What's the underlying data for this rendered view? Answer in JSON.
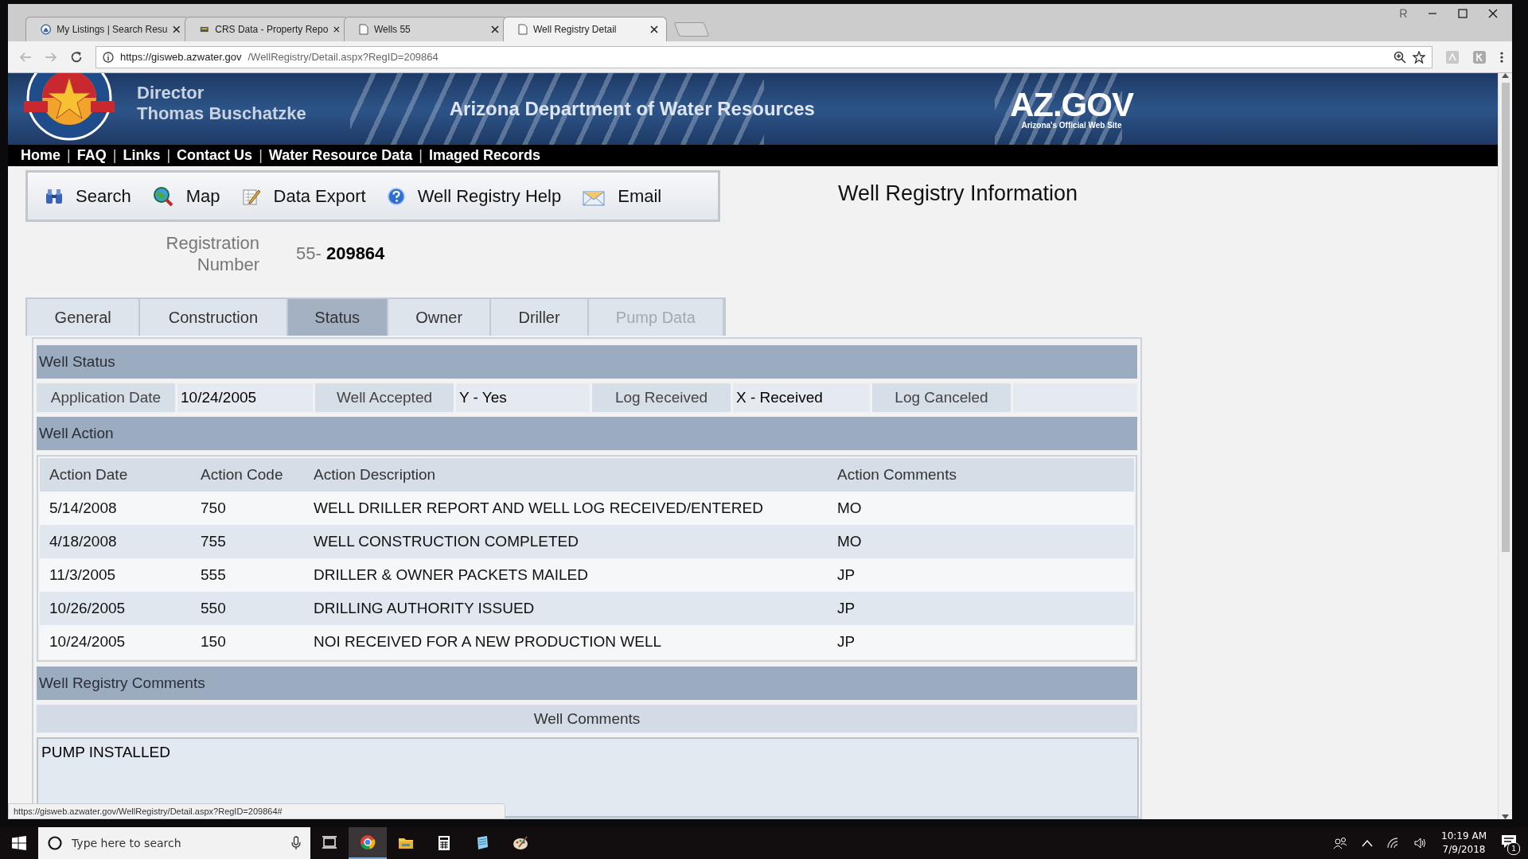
{
  "browser": {
    "tabs": [
      {
        "title": "My Listings | Search Resu",
        "kind": "listing",
        "selected": false
      },
      {
        "title": "CRS Data - Property Repo",
        "kind": "data",
        "selected": false
      },
      {
        "title": "Wells 55",
        "kind": "page",
        "selected": false
      },
      {
        "title": "Well Registry Detail",
        "kind": "page",
        "selected": true
      }
    ],
    "url_host": "https://gisweb.azwater.gov",
    "url_path": "/WellRegistry/Detail.aspx?RegID=209864",
    "status_url": "https://gisweb.azwater.gov/WellRegistry/Detail.aspx?RegID=209864#"
  },
  "header": {
    "director_label": "Director",
    "director_name": "Thomas Buschatzke",
    "agency": "Arizona Department of Water Resources",
    "portal_logo": "AZ.GOV",
    "portal_tagline": "Arizona's Official Web Site"
  },
  "nav_separator": "|",
  "nav": [
    "Home",
    "FAQ",
    "Links",
    "Contact Us",
    "Water Resource Data",
    "Imaged Records"
  ],
  "toolbar": [
    {
      "label": "Search",
      "kind": "search"
    },
    {
      "label": "Map",
      "kind": "map"
    },
    {
      "label": "Data Export",
      "kind": "export"
    },
    {
      "label": "Well Registry Help",
      "kind": "help"
    },
    {
      "label": "Email",
      "kind": "email"
    }
  ],
  "page_title": "Well Registry Information",
  "registration": {
    "label": "Registration Number",
    "prefix": "55-",
    "number": "209864"
  },
  "tabs": [
    {
      "label": "General",
      "selected": false,
      "disabled": false
    },
    {
      "label": "Construction",
      "selected": false,
      "disabled": false
    },
    {
      "label": "Status",
      "selected": true,
      "disabled": false
    },
    {
      "label": "Owner",
      "selected": false,
      "disabled": false
    },
    {
      "label": "Driller",
      "selected": false,
      "disabled": false
    },
    {
      "label": "Pump Data",
      "selected": false,
      "disabled": true
    }
  ],
  "well_status": {
    "title": "Well Status",
    "fields": [
      {
        "label": "Application Date",
        "value": "10/24/2005"
      },
      {
        "label": "Well Accepted",
        "value": "Y - Yes"
      },
      {
        "label": "Log Received",
        "value": "X - Received"
      },
      {
        "label": "Log Canceled"
      }
    ]
  },
  "well_action": {
    "title": "Well Action",
    "columns": [
      "Action Date",
      "Action Code",
      "Action Description",
      "Action Comments"
    ],
    "rows": [
      [
        "5/14/2008",
        "750",
        "WELL DRILLER REPORT AND WELL LOG RECEIVED/ENTERED",
        "MO"
      ],
      [
        "4/18/2008",
        "755",
        "WELL CONSTRUCTION COMPLETED",
        "MO"
      ],
      [
        "11/3/2005",
        "555",
        "DRILLER & OWNER PACKETS MAILED",
        "JP"
      ],
      [
        "10/26/2005",
        "550",
        "DRILLING AUTHORITY ISSUED",
        "JP"
      ],
      [
        "10/24/2005",
        "150",
        "NOI RECEIVED FOR A NEW PRODUCTION WELL",
        "JP"
      ]
    ]
  },
  "comments": {
    "title": "Well Registry Comments",
    "subtitle": "Well Comments",
    "text": "PUMP INSTALLED"
  },
  "taskbar": {
    "search_placeholder": "Type here to search",
    "time": "10:19 AM",
    "date": "7/9/2018",
    "notification_count": "1"
  }
}
